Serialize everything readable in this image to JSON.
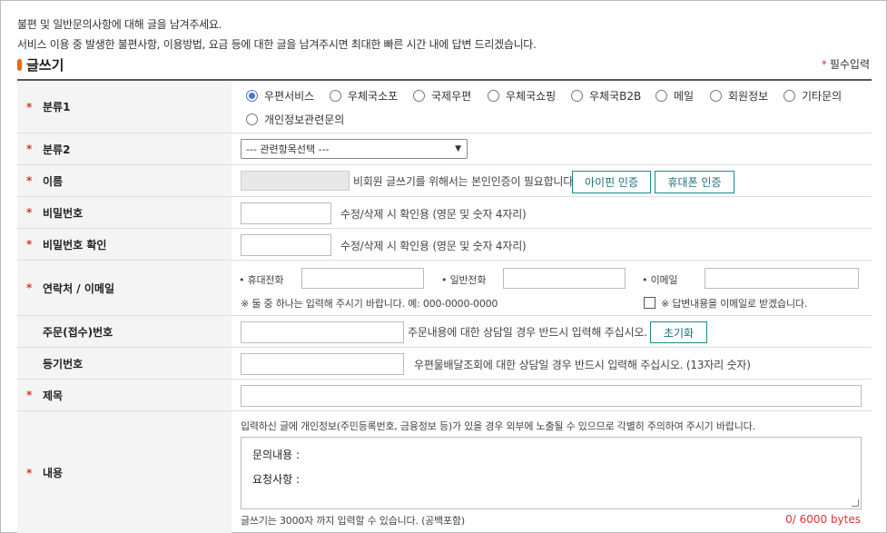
{
  "intro": {
    "line1": "불편 및 일반문의사항에 대해 글을 남겨주세요.",
    "line2": "서비스 이용 중 발생한 불편사항, 이용방법, 요금 등에 대한 글을 남겨주시면 최대한 빠른 시간 내에 답변 드리겠습니다."
  },
  "heading": {
    "title": "글쓰기",
    "required_star": "*",
    "required_label": "필수입력"
  },
  "colors": {
    "accent": "#e86a1a",
    "required": "#d33333",
    "button": "#1b8a8a",
    "radio": "#4a74d8"
  },
  "category1": {
    "label": "분류1",
    "options": [
      "우편서비스",
      "우체국소포",
      "국제우편",
      "우체국쇼핑",
      "우체국B2B",
      "메일",
      "회원정보",
      "기타문의",
      "개인정보관련문의"
    ],
    "selected": "우편서비스"
  },
  "category2": {
    "label": "분류2",
    "value": "--- 관련항목선택 ---"
  },
  "name": {
    "label": "이름",
    "note": "비회원 글쓰기를 위해서는 본인인증이 필요합니다.",
    "ipin_button": "아이핀 인증",
    "phone_button": "휴대폰 인증"
  },
  "password": {
    "label": "비밀번호",
    "hint": "수정/삭제 시 확인용 (영문 및 숫자 4자리)"
  },
  "password_confirm": {
    "label": "비밀번호 확인",
    "hint": "수정/삭제 시 확인용 (영문 및 숫자 4자리)"
  },
  "contact": {
    "label": "연락처 / 이메일",
    "mobile_label": "• 휴대전화",
    "phone_label": "• 일반전화",
    "email_label": "• 이메일",
    "note": "※ 둘 중 하나는 입력해 주시기 바랍니다. 예: 000-0000-0000",
    "email_reply_label": "※ 답변내용을 이메일로 받겠습니다."
  },
  "order_no": {
    "label": "주문(접수)번호",
    "hint": "주문내용에 대한 상담일 경우 반드시 입력해 주십시오.",
    "reset_button": "초기화"
  },
  "registered_no": {
    "label": "등기번호",
    "hint": "우편물배달조회에 대한 상담일 경우 반드시 입력해 주십시오. (13자리 숫자)"
  },
  "subject": {
    "label": "제목"
  },
  "body": {
    "label": "내용",
    "warning": "입력하신 글에 개인정보(주민등록번호, 금융정보 등)가 있을 경우 외부에 노출될 수 있으므로 각별히 주의하여 주시기 바랍니다.",
    "line1": "문의내용 :",
    "line2": "요청사항 :",
    "limit_note": "글쓰기는 3000자 까지 입력할 수 있습니다. (공백포함)",
    "counter": "0/ 6000 bytes"
  }
}
